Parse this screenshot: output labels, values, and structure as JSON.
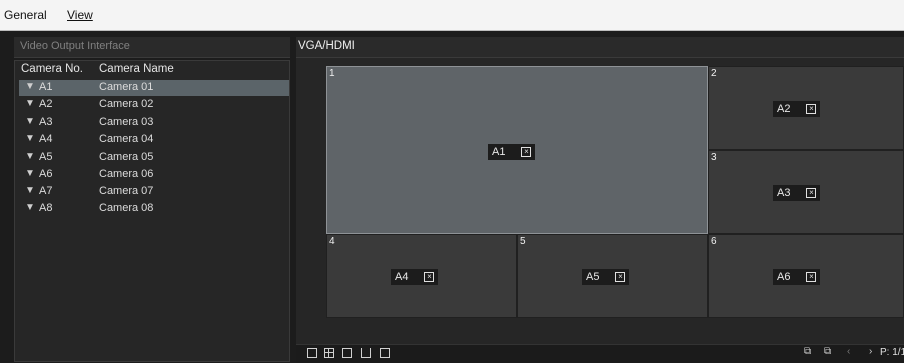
{
  "tabs": {
    "general": "General",
    "view": "View"
  },
  "left_panel": {
    "title": "Video Output Interface",
    "col_camera_no": "Camera No.",
    "col_camera_name": "Camera Name",
    "cameras": [
      {
        "no": "A1",
        "name": "Camera 01"
      },
      {
        "no": "A2",
        "name": "Camera 02"
      },
      {
        "no": "A3",
        "name": "Camera 03"
      },
      {
        "no": "A4",
        "name": "Camera 04"
      },
      {
        "no": "A5",
        "name": "Camera 05"
      },
      {
        "no": "A6",
        "name": "Camera 06"
      },
      {
        "no": "A7",
        "name": "Camera 07"
      },
      {
        "no": "A8",
        "name": "Camera 08"
      }
    ],
    "selected_index": 0
  },
  "right_panel": {
    "title": "VGA/HDMI",
    "tiles": [
      {
        "num": "1",
        "camera": "A1"
      },
      {
        "num": "2",
        "camera": "A2"
      },
      {
        "num": "3",
        "camera": "A3"
      },
      {
        "num": "4",
        "camera": "A4"
      },
      {
        "num": "5",
        "camera": "A5"
      },
      {
        "num": "6",
        "camera": "A6"
      }
    ]
  },
  "toolbar": {
    "page_indicator": "P: 1/1",
    "icons": [
      "layout-1x1-icon",
      "layout-2x2-icon",
      "layout-3x3-icon",
      "layout-4x4-icon",
      "layout-custom-icon",
      "prev-layout-icon",
      "next-layout-icon",
      "prev-page-icon",
      "next-page-icon"
    ]
  }
}
